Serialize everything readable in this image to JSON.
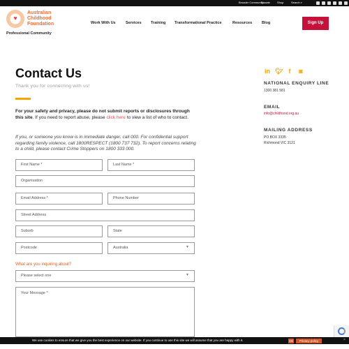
{
  "topbar": {
    "broader": "Broader Community →",
    "donate": "Donate",
    "shop": "Shop",
    "search": "Search ⌕",
    "social_icons": [
      "facebook-icon",
      "twitter-icon",
      "instagram-icon",
      "youtube-icon",
      "linkedin-icon",
      "more-icon"
    ]
  },
  "logo": {
    "line1": "Australian",
    "line2": "Childhood",
    "line3": "Foundation",
    "sub": "Professional Community"
  },
  "nav": {
    "items": [
      "Work With Us",
      "Services",
      "Training",
      "Transformational Practice",
      "Resources",
      "Blog"
    ],
    "signup": "Sign Up"
  },
  "page": {
    "title": "Contact Us",
    "subtitle": "Thank you for connecting with us!",
    "notice_bold": "For your safety and privacy, please do not submit reports or disclosures through this site",
    "notice_mid": ". If you need to report abuse, please ",
    "notice_link": "click here",
    "notice_end": " to view a list of who to contact.",
    "notice2": "If you, or someone you know is in immediate danger, call 000. For confidential support regarding family violence, call 1800RESPECT (1800 737 732). To report concerns relating to a child, please contact Crime Stoppers on 1800 333 000."
  },
  "form": {
    "first_name": "First Name *",
    "last_name": "Last Name *",
    "organisation": "Organisation",
    "email": "Email Address *",
    "phone": "Phone Number",
    "street": "Street Address",
    "suburb": "Suburb",
    "state": "State",
    "postcode": "Postcode",
    "country": "Australia",
    "inquiry_label": "What are you inquiring about?",
    "inquiry_select": "Please select one",
    "message": "Your Message *"
  },
  "sidebar": {
    "social": [
      "linkedin-icon",
      "twitter-icon",
      "facebook-icon",
      "instagram-icon"
    ],
    "enquiry_heading": "NATIONAL ENQUIRY LINE",
    "enquiry_value": "1300 381 581",
    "email_heading": "EMAIL",
    "email_value": "info@childhood.org.au",
    "mailing_heading": "MAILING ADDRESS",
    "mailing_line1": "PO BOX 3335",
    "mailing_line2": "Richmond VIC 3121"
  },
  "cookie": {
    "text": "We use cookies to ensure that we give you the best experience on our website. If you continue to use this site we will assume that you are happy with it.",
    "ok": "Ok",
    "privacy": "Privacy policy",
    "close": "×"
  },
  "colors": {
    "brand_orange": "#f06b30",
    "accent_yellow": "#f0a500",
    "signup_red": "#c4123a"
  }
}
